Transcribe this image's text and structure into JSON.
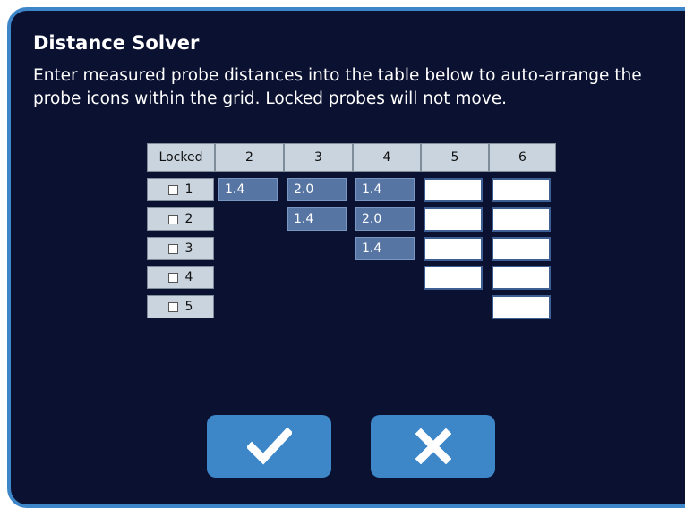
{
  "dialog": {
    "title": "Distance Solver",
    "description": "Enter measured probe distances into the table below to auto-arrange the probe icons within the grid.  Locked probes will not move."
  },
  "table": {
    "corner_label": "Locked",
    "columns": [
      "2",
      "3",
      "4",
      "5",
      "6"
    ],
    "rows": [
      {
        "label": "1",
        "locked": false,
        "cells": [
          "1.4",
          "2.0",
          "1.4",
          "",
          ""
        ]
      },
      {
        "label": "2",
        "locked": false,
        "cells": [
          null,
          "1.4",
          "2.0",
          "",
          ""
        ]
      },
      {
        "label": "3",
        "locked": false,
        "cells": [
          null,
          null,
          "1.4",
          "",
          ""
        ]
      },
      {
        "label": "4",
        "locked": false,
        "cells": [
          null,
          null,
          null,
          "",
          ""
        ]
      },
      {
        "label": "5",
        "locked": false,
        "cells": [
          null,
          null,
          null,
          null,
          ""
        ]
      }
    ]
  },
  "buttons": {
    "confirm_icon": "check-icon",
    "cancel_icon": "close-icon"
  },
  "colors": {
    "background": "#0b1130",
    "accent": "#3d86c8",
    "filled_cell": "#5675a3",
    "header": "#c9d4df"
  }
}
